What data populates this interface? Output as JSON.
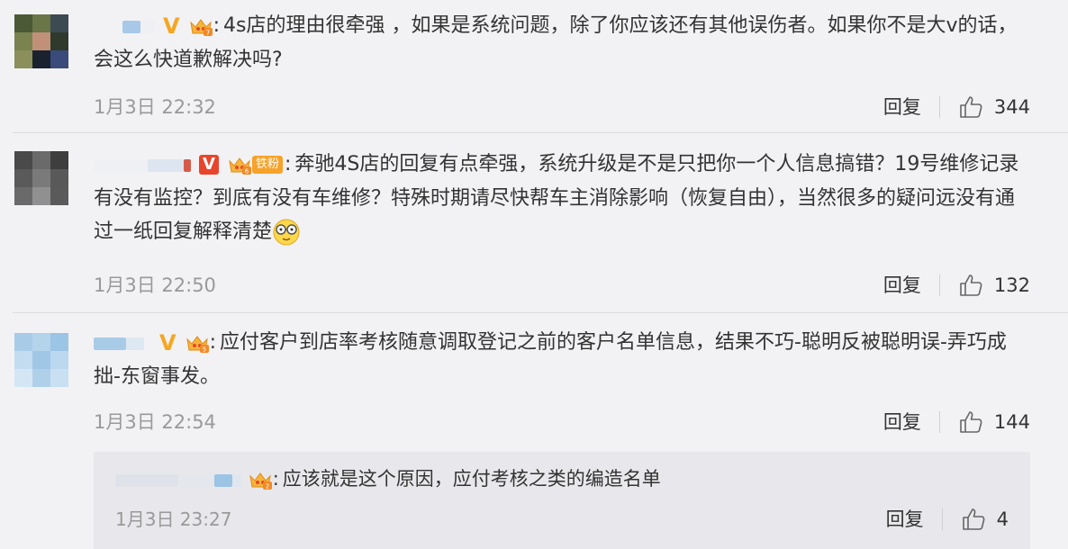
{
  "comments": [
    {
      "text": "4s店的理由很牵强 ，如果是系统问题，除了你应该还有其他误伤者。如果你不是大v的话，会这么快道歉解决吗?",
      "badge": "V",
      "time": "1月3日 22:32",
      "reply": "回复",
      "likes": "344"
    },
    {
      "badge": "V",
      "fan_badge": "铁粉",
      "text": "奔驰4S店的回复有点牵强，系统升级是不是只把你一个人信息搞错？19号维修记录有没有监控？到底有没有车维修？特殊时期请尽快帮车主消除影响（恢复自由），当然很多的疑问远没有通过一纸回复解释清楚",
      "time": "1月3日 22:50",
      "reply": "回复",
      "likes": "132"
    },
    {
      "badge": "V",
      "text": "应付客户到店率考核随意调取登记之前的客户名单信息，结果不巧-聪明反被聪明误-弄巧成拙-东窗事发。",
      "time": "1月3日 22:54",
      "reply": "回复",
      "likes": "144"
    }
  ],
  "subreply": {
    "text": "应该就是这个原因，应付考核之类的编造名单",
    "time": "1月3日 23:27",
    "reply": "回复",
    "likes": "4"
  },
  "colors": {
    "background": "#f2f2f5",
    "vip_gold": "#f5a623",
    "vip_red": "#e8452c",
    "muted": "#999999"
  },
  "icons": [
    "crown-icon",
    "like-thumb-icon",
    "emoji-glasses-icon"
  ]
}
